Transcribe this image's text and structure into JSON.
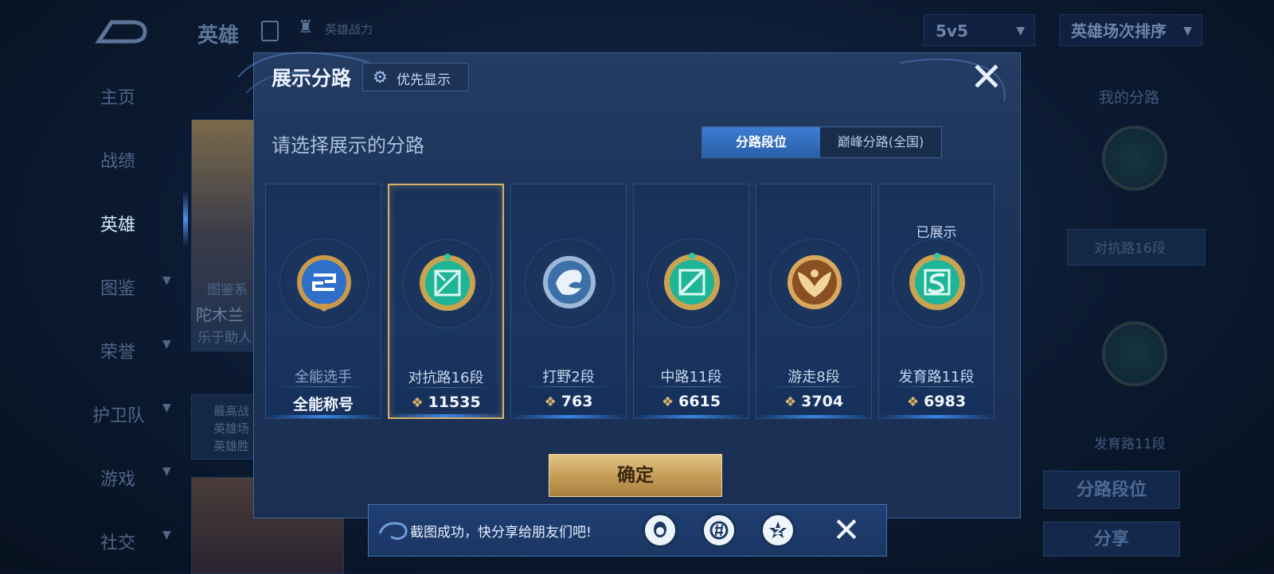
{
  "background": {
    "title": "英雄",
    "power_label": "英雄战力",
    "mode_dropdown": "5v5",
    "sort_dropdown": "英雄场次排序",
    "nav": [
      {
        "label": "主页",
        "has_chevron": false
      },
      {
        "label": "战绩",
        "has_chevron": false
      },
      {
        "label": "英雄",
        "has_chevron": false,
        "active": true
      },
      {
        "label": "图鉴",
        "has_chevron": true
      },
      {
        "label": "荣誉",
        "has_chevron": true
      },
      {
        "label": "护卫队",
        "has_chevron": true
      },
      {
        "label": "游戏",
        "has_chevron": true
      },
      {
        "label": "社交",
        "has_chevron": true
      }
    ],
    "card_snippets": [
      "图鉴系",
      "陀木兰",
      "乐于助人",
      "最高战",
      "英雄场",
      "英雄胜"
    ],
    "right_panel": {
      "title": "我的分路",
      "lane1_label": "对抗路16段",
      "lane2_label": "发育路11段",
      "segment_button": "分路段位",
      "share_button": "分享"
    }
  },
  "modal": {
    "title": "展示分路",
    "priority_button": "优先显示",
    "prompt": "请选择展示的分路",
    "toggle": {
      "active": "分路段位",
      "inactive": "巅峰分路(全国)"
    },
    "cards": [
      {
        "lane": "全能选手",
        "score": "全能称号",
        "has_points_icon": false,
        "selected": false,
        "shown_label": "",
        "badge": "all-round-badge",
        "badge_color": "#3b7bd6"
      },
      {
        "lane": "对抗路16段",
        "score": "11535",
        "has_points_icon": true,
        "selected": true,
        "shown_label": "",
        "badge": "clash-lane-badge",
        "badge_color": "#2fc7a6"
      },
      {
        "lane": "打野2段",
        "score": "763",
        "has_points_icon": true,
        "selected": false,
        "shown_label": "",
        "badge": "jungle-badge",
        "badge_color": "#6f9cd1"
      },
      {
        "lane": "中路11段",
        "score": "6615",
        "has_points_icon": true,
        "selected": false,
        "shown_label": "",
        "badge": "mid-lane-badge",
        "badge_color": "#2fc7a6"
      },
      {
        "lane": "游走8段",
        "score": "3704",
        "has_points_icon": true,
        "selected": false,
        "shown_label": "",
        "badge": "roam-badge",
        "badge_color": "#c9843e"
      },
      {
        "lane": "发育路11段",
        "score": "6983",
        "has_points_icon": true,
        "selected": false,
        "shown_label": "已展示",
        "badge": "farm-lane-badge",
        "badge_color": "#2fc7a6"
      }
    ],
    "confirm_button": "确定"
  },
  "toast": {
    "text": "截图成功，快分享给朋友们吧!",
    "share_targets": [
      "qq-icon",
      "wechat-moments-icon",
      "qzone-icon"
    ]
  },
  "colors": {
    "accent_blue": "#3d7dd3",
    "gold": "#d7b06b",
    "teal_badge": "#2fc7a6"
  }
}
